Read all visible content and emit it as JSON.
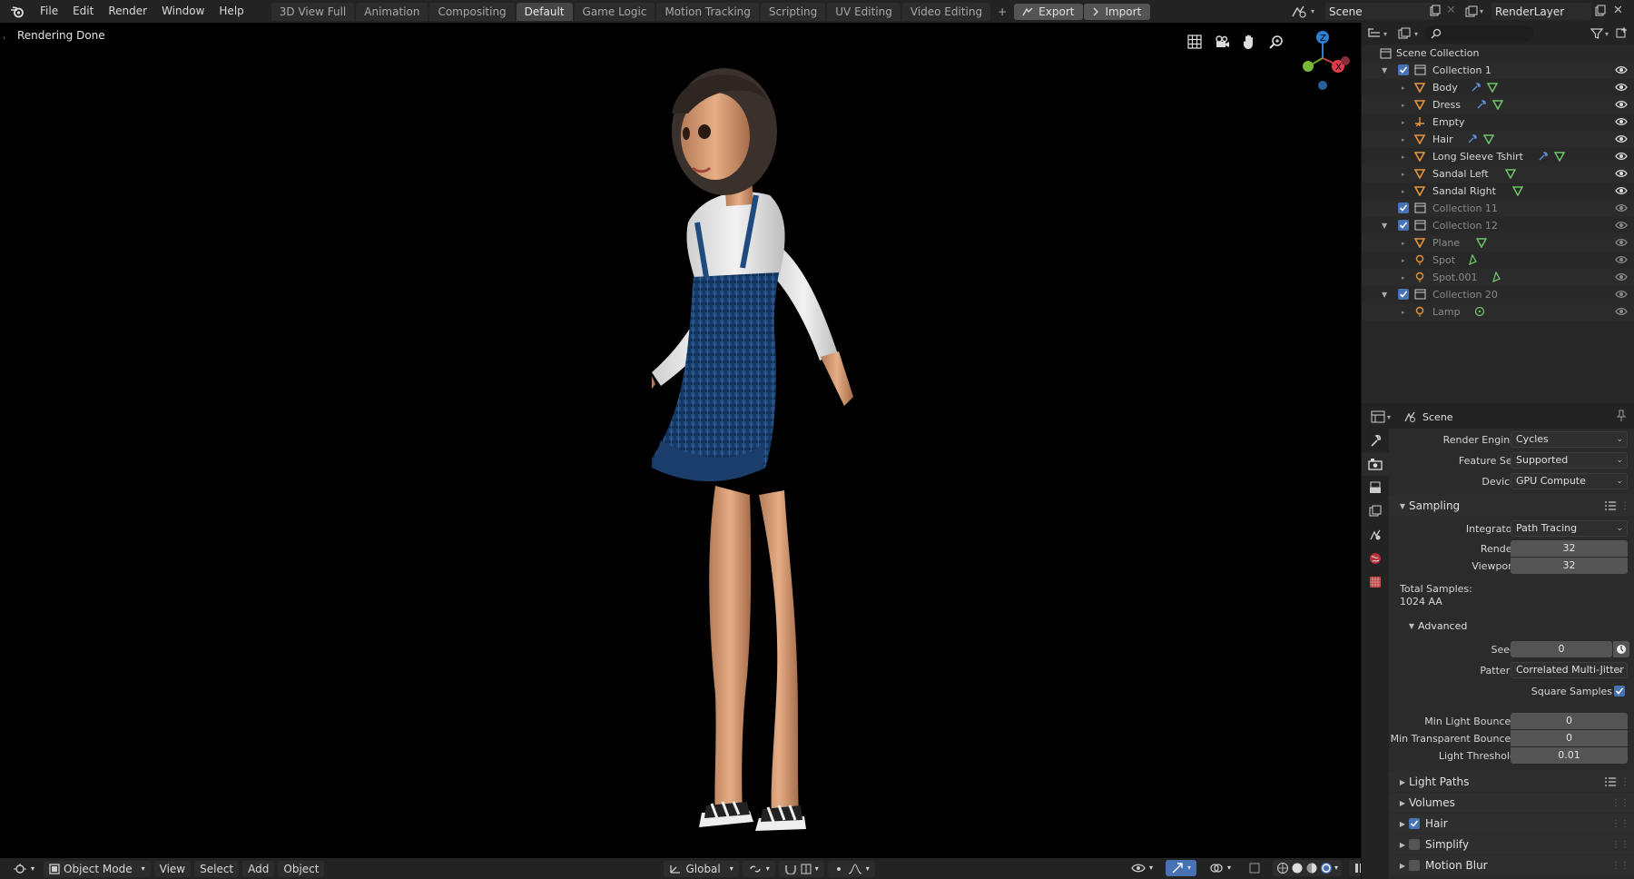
{
  "menu": [
    "File",
    "Edit",
    "Render",
    "Window",
    "Help"
  ],
  "workspaces": [
    {
      "label": "3D View Full",
      "active": false
    },
    {
      "label": "Animation",
      "active": false
    },
    {
      "label": "Compositing",
      "active": false
    },
    {
      "label": "Default",
      "active": true
    },
    {
      "label": "Game Logic",
      "active": false
    },
    {
      "label": "Motion Tracking",
      "active": false
    },
    {
      "label": "Scripting",
      "active": false
    },
    {
      "label": "UV Editing",
      "active": false
    },
    {
      "label": "Video Editing",
      "active": false
    }
  ],
  "workspace_add": "+",
  "export_label": "Export",
  "import_label": "Import",
  "scene_name": "Scene",
  "render_layer": "RenderLayer",
  "viewport": {
    "status": "Rendering Done"
  },
  "bottom": {
    "mode": "Object Mode",
    "view": "View",
    "select": "Select",
    "add": "Add",
    "object": "Object",
    "orientation": "Global"
  },
  "outliner": {
    "root": "Scene Collection",
    "items": [
      {
        "label": "Collection 1",
        "kind": "collection",
        "depth": 0,
        "expanded": true,
        "dim": false
      },
      {
        "label": "Body",
        "kind": "mesh",
        "depth": 1,
        "dim": false,
        "mods": [
          "wrench",
          "tri"
        ]
      },
      {
        "label": "Dress",
        "kind": "mesh",
        "depth": 1,
        "dim": false,
        "mods": [
          "wrench",
          "tri"
        ]
      },
      {
        "label": "Empty",
        "kind": "empty",
        "depth": 1,
        "dim": false,
        "mods": []
      },
      {
        "label": "Hair",
        "kind": "mesh",
        "depth": 1,
        "dim": false,
        "mods": [
          "wrench",
          "tri"
        ]
      },
      {
        "label": "Long Sleeve Tshirt",
        "kind": "mesh",
        "depth": 1,
        "dim": false,
        "mods": [
          "wrench",
          "tri"
        ]
      },
      {
        "label": "Sandal Left",
        "kind": "mesh",
        "depth": 1,
        "dim": false,
        "mods": [
          "tri"
        ]
      },
      {
        "label": "Sandal Right",
        "kind": "mesh",
        "depth": 1,
        "dim": false,
        "mods": [
          "tri"
        ]
      },
      {
        "label": "Collection 11",
        "kind": "collection",
        "depth": 0,
        "expanded": false,
        "dim": true
      },
      {
        "label": "Collection 12",
        "kind": "collection",
        "depth": 0,
        "expanded": true,
        "dim": true
      },
      {
        "label": "Plane",
        "kind": "mesh",
        "depth": 1,
        "dim": true,
        "mods": [
          "tri"
        ]
      },
      {
        "label": "Spot",
        "kind": "light",
        "depth": 1,
        "dim": true,
        "mods": [
          "lightdata"
        ]
      },
      {
        "label": "Spot.001",
        "kind": "light",
        "depth": 1,
        "dim": true,
        "mods": [
          "lightdata"
        ]
      },
      {
        "label": "Collection 20",
        "kind": "collection",
        "depth": 0,
        "expanded": true,
        "dim": true
      },
      {
        "label": "Lamp",
        "kind": "light",
        "depth": 1,
        "dim": true,
        "mods": [
          "lampdata"
        ]
      }
    ]
  },
  "properties": {
    "context": "Scene",
    "render_engine_label": "Render Engine",
    "render_engine": "Cycles",
    "feature_set_label": "Feature Set",
    "feature_set": "Supported",
    "device_label": "Device",
    "device": "GPU Compute",
    "sampling": "Sampling",
    "integrator_label": "Integrator",
    "integrator": "Path Tracing",
    "render_label": "Render",
    "render_samples": "32",
    "viewport_label": "Viewport",
    "viewport_samples": "32",
    "total_samples_label": "Total Samples:",
    "total_samples": "1024 AA",
    "advanced": "Advanced",
    "seed_label": "Seed",
    "seed": "0",
    "pattern_label": "Pattern",
    "pattern": "Correlated Multi-Jitter",
    "square_samples_label": "Square Samples",
    "min_light_bounces_label": "Min Light Bounces",
    "min_light_bounces": "0",
    "min_transparent_bounces_label": "Min Transparent Bounces",
    "min_transparent_bounces": "0",
    "light_threshold_label": "Light Threshold",
    "light_threshold": "0.01",
    "light_paths": "Light Paths",
    "volumes": "Volumes",
    "hair": "Hair",
    "simplify": "Simplify",
    "motion_blur": "Motion Blur"
  }
}
